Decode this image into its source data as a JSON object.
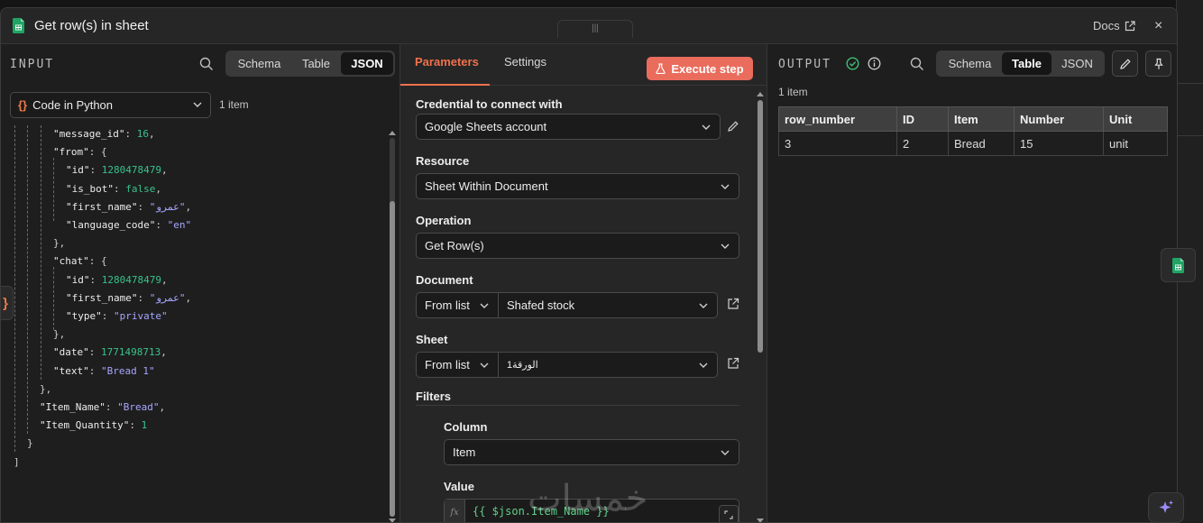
{
  "header": {
    "title": "Get row(s) in sheet",
    "docs_label": "Docs",
    "close_label": "×"
  },
  "input": {
    "title": "INPUT",
    "view_tabs": [
      "Schema",
      "Table",
      "JSON"
    ],
    "active_tab": "JSON",
    "node_select": {
      "braces": "{}",
      "label": "Code in Python"
    },
    "items_count": "1 item",
    "side_tab_label": "}",
    "json_lines": [
      {
        "key": "\"message_id\"",
        "sep": ": ",
        "value": "16",
        "vtype": "num",
        "tail": ","
      },
      {
        "key": "\"from\"",
        "sep": ": ",
        "value": "{",
        "vtype": "punc",
        "tail": ""
      },
      {
        "key": "\"id\"",
        "sep": ": ",
        "value": "1280478479",
        "vtype": "num",
        "tail": ","
      },
      {
        "key": "\"is_bot\"",
        "sep": ": ",
        "value": "false",
        "vtype": "num",
        "tail": ","
      },
      {
        "key": "\"first_name\"",
        "sep": ": ",
        "value": "\"عمرو\"",
        "vtype": "str",
        "tail": ","
      },
      {
        "key": "\"language_code\"",
        "sep": ": ",
        "value": "\"en\"",
        "vtype": "str",
        "tail": ""
      },
      {
        "key": "",
        "sep": "",
        "value": "},",
        "vtype": "punc",
        "tail": ""
      },
      {
        "key": "\"chat\"",
        "sep": ": ",
        "value": "{",
        "vtype": "punc",
        "tail": ""
      },
      {
        "key": "\"id\"",
        "sep": ": ",
        "value": "1280478479",
        "vtype": "num",
        "tail": ","
      },
      {
        "key": "\"first_name\"",
        "sep": ": ",
        "value": "\"عمرو\"",
        "vtype": "str",
        "tail": ","
      },
      {
        "key": "\"type\"",
        "sep": ": ",
        "value": "\"private\"",
        "vtype": "str",
        "tail": ""
      },
      {
        "key": "",
        "sep": "",
        "value": "},",
        "vtype": "punc",
        "tail": ""
      },
      {
        "key": "\"date\"",
        "sep": ": ",
        "value": "1771498713",
        "vtype": "num",
        "tail": ","
      },
      {
        "key": "\"text\"",
        "sep": ": ",
        "value": "\"Bread 1\"",
        "vtype": "str",
        "tail": ""
      },
      {
        "key": "",
        "sep": "",
        "value": "},",
        "vtype": "punc",
        "tail": ""
      },
      {
        "key": "\"Item_Name\"",
        "sep": ": ",
        "value": "\"Bread\"",
        "vtype": "str",
        "tail": ","
      },
      {
        "key": "\"Item_Quantity\"",
        "sep": ": ",
        "value": "1",
        "vtype": "num",
        "tail": ""
      },
      {
        "key": "",
        "sep": "",
        "value": "}",
        "vtype": "punc",
        "tail": ""
      },
      {
        "key": "",
        "sep": "",
        "value": "]",
        "vtype": "punc",
        "tail": ""
      }
    ]
  },
  "params": {
    "tabs": [
      "Parameters",
      "Settings"
    ],
    "active_tab": "Parameters",
    "execute_label": "Execute step",
    "credential_label": "Credential to connect with",
    "credential_value": "Google Sheets account",
    "resource_label": "Resource",
    "resource_value": "Sheet Within Document",
    "operation_label": "Operation",
    "operation_value": "Get Row(s)",
    "document_label": "Document",
    "document_mode": "From list",
    "document_value": "Shafed stock",
    "sheet_label": "Sheet",
    "sheet_mode": "From list",
    "sheet_value": "الورقة1",
    "filters_label": "Filters",
    "column_label": "Column",
    "column_value": "Item",
    "value_label": "Value",
    "value_fx": "fx",
    "value_expression": "{{ $json.Item_Name }}",
    "drag_handle": "|||"
  },
  "output": {
    "title": "OUTPUT",
    "view_tabs": [
      "Schema",
      "Table",
      "JSON"
    ],
    "active_tab": "Table",
    "items_count": "1 item",
    "columns": [
      "row_number",
      "ID",
      "Item",
      "Number",
      "Unit"
    ],
    "rows": [
      [
        "3",
        "2",
        "Bread",
        "15",
        "unit"
      ]
    ]
  },
  "watermark": "خمسات",
  "colors": {
    "accent": "#f2714b",
    "execute": "#ea6c5c",
    "success": "#3fbf75",
    "sheets_green": "#1fa463"
  }
}
